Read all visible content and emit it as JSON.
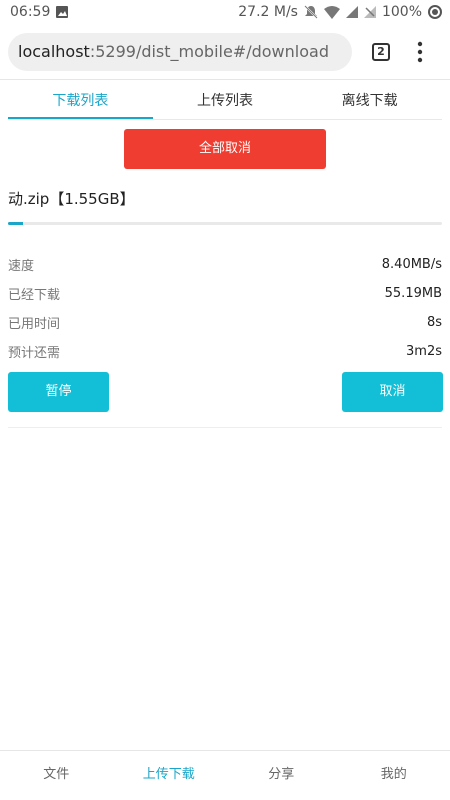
{
  "status_bar": {
    "time": "06:59",
    "network_speed": "27.2 M/s",
    "battery": "100%",
    "icons": [
      "image-icon",
      "mute-icon",
      "wifi-icon",
      "signal-icon",
      "no-signal-icon",
      "battery-icon"
    ]
  },
  "browser": {
    "url_host": "localhost",
    "url_path": ":5299/dist_mobile#/download",
    "tab_count": "2"
  },
  "tabs": {
    "items": [
      {
        "label": "下载列表",
        "active": true
      },
      {
        "label": "上传列表",
        "active": false
      },
      {
        "label": "离线下载",
        "active": false
      }
    ]
  },
  "actions": {
    "cancel_all": "全部取消",
    "pause": "暂停",
    "cancel": "取消"
  },
  "download": {
    "file_name": "动.zip【1.55GB】",
    "progress_percent": 3.5,
    "stats": [
      {
        "label": "速度",
        "value": "8.40MB/s"
      },
      {
        "label": "已经下载",
        "value": "55.19MB"
      },
      {
        "label": "已用时间",
        "value": "8s"
      },
      {
        "label": "预计还需",
        "value": "3m2s"
      }
    ]
  },
  "bottom_nav": {
    "items": [
      {
        "label": "文件",
        "active": false
      },
      {
        "label": "上传下载",
        "active": true
      },
      {
        "label": "分享",
        "active": false
      },
      {
        "label": "我的",
        "active": false
      }
    ]
  },
  "colors": {
    "accent": "#1aa6c9",
    "button": "#12bfd6",
    "danger": "#ef3e31"
  }
}
